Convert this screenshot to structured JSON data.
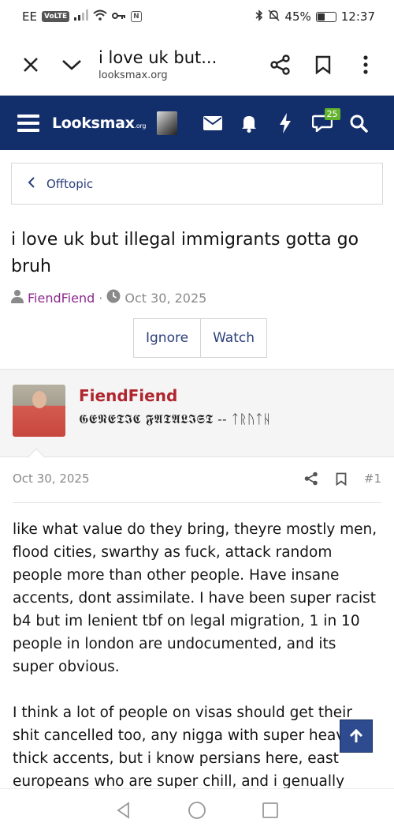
{
  "status_bar": {
    "carrier": "EE",
    "volte": "VoLTE",
    "nfc": "N",
    "battery_percent": "45%",
    "battery_level": 0.45,
    "time": "12:37"
  },
  "browser": {
    "page_title": "i love uk but...",
    "host": "looksmax.org"
  },
  "site_nav": {
    "logo_text": "Looksmax",
    "logo_suffix": ".org",
    "alerts_count": "25"
  },
  "breadcrumb": {
    "label": "Offtopic"
  },
  "thread": {
    "title": "i love uk but illegal immigrants gotta go bruh",
    "author": "FiendFiend",
    "separator": "·",
    "date": "Oct 30, 2025",
    "ignore_label": "Ignore",
    "watch_label": "Watch"
  },
  "post": {
    "username": "FiendFiend",
    "user_title": "𝕲𝕰𝕹𝕰𝕿𝕴𝕮 𝕱𝕬𝕿𝕬𝕷𝕴𝕾𝕿 -- ᛏᚱᚢᛏᚺ",
    "date": "Oct 30, 2025",
    "post_number": "#1",
    "paragraphs": [
      "like what value do they bring, theyre mostly men, flood cities, swarthy as fuck, attack random people more than other people. Have insane accents, dont assimilate. I have been super racist b4 but im lenient tbf on legal migration, 1 in 10 people in london are undocumented, and its super obvious.",
      "I think a lot of people on visas should get their shit cancelled too, any nigga with super heavy thick accents, but i know persians here, east europeans who are super chill, and i genually think contribute"
    ]
  }
}
